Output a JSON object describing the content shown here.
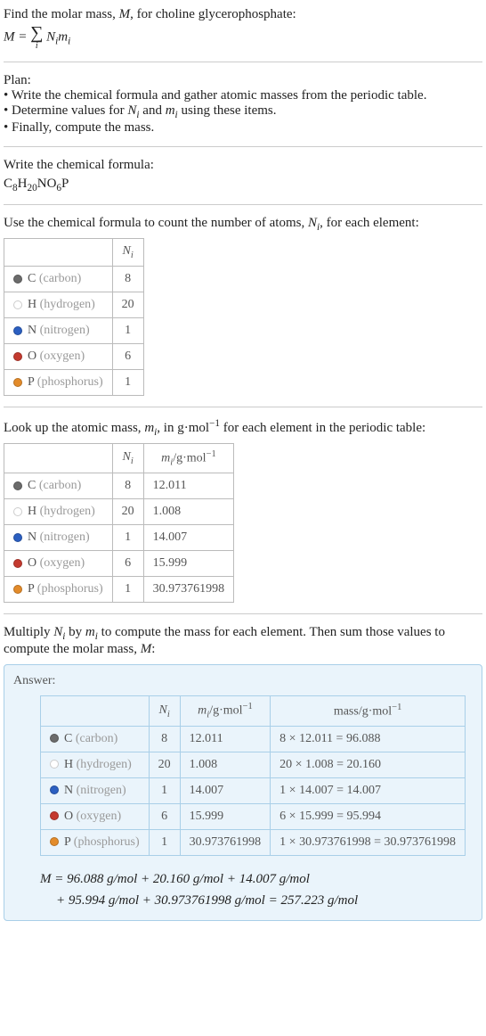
{
  "intro": {
    "line1": "Find the molar mass, ",
    "line1_var": "M",
    "line1_rest": ", for choline glycerophosphate:"
  },
  "equation_main": {
    "lhs": "M = ",
    "sum_symbol": "∑",
    "sum_index": "i",
    "rhs_Ni": "N",
    "rhs_i1": "i",
    "rhs_mi": "m",
    "rhs_i2": "i"
  },
  "plan": {
    "title": "Plan:",
    "item1_a": "• Write the chemical formula and gather atomic masses from the periodic table.",
    "item2_a": "• Determine values for ",
    "item2_Ni": "N",
    "item2_i1": "i",
    "item2_mid": " and ",
    "item2_mi": "m",
    "item2_i2": "i",
    "item2_end": " using these items.",
    "item3": "• Finally, compute the mass."
  },
  "chemformula": {
    "title": "Write the chemical formula:",
    "C": "C",
    "c8": "8",
    "H": "H",
    "h20": "20",
    "N": "N",
    "O": "O",
    "o6": "6",
    "P": "P"
  },
  "count_section": {
    "intro_a": "Use the chemical formula to count the number of atoms, ",
    "intro_Ni": "N",
    "intro_i": "i",
    "intro_b": ", for each element:"
  },
  "headers": {
    "Ni": "N",
    "Ni_i": "i",
    "mi_pre": "m",
    "mi_i": "i",
    "mi_unit": "/g·mol",
    "mi_exp": "−1",
    "mass_label": "mass/g·mol",
    "mass_exp": "−1"
  },
  "elements": [
    {
      "dot": "#6b6b6b",
      "sym": "C",
      "name": " (carbon)",
      "n": "8",
      "m": "12.011",
      "mass": "8 × 12.011 = 96.088"
    },
    {
      "dot": "#ffffff",
      "sym": "H",
      "name": " (hydrogen)",
      "n": "20",
      "m": "1.008",
      "mass": "20 × 1.008 = 20.160"
    },
    {
      "dot": "#2b5fc1",
      "sym": "N",
      "name": " (nitrogen)",
      "n": "1",
      "m": "14.007",
      "mass": "1 × 14.007 = 14.007"
    },
    {
      "dot": "#c43a2f",
      "sym": "O",
      "name": " (oxygen)",
      "n": "6",
      "m": "15.999",
      "mass": "6 × 15.999 = 95.994"
    },
    {
      "dot": "#e38b2a",
      "sym": "P",
      "name": " (phosphorus)",
      "n": "1",
      "m": "30.973761998",
      "mass": "1 × 30.973761998 = 30.973761998"
    }
  ],
  "lookup_section": {
    "intro_a": "Look up the atomic mass, ",
    "intro_mi": "m",
    "intro_i": "i",
    "intro_b": ", in g·mol",
    "intro_exp": "−1",
    "intro_c": " for each element in the periodic table:"
  },
  "multiply_section": {
    "text_a": "Multiply ",
    "Ni": "N",
    "i1": "i",
    "text_b": " by ",
    "mi": "m",
    "i2": "i",
    "text_c": " to compute the mass for each element. Then sum those values to compute the molar mass, ",
    "Mvar": "M",
    "text_d": ":"
  },
  "answer": {
    "label": "Answer:",
    "final_line1": "M = 96.088 g/mol + 20.160 g/mol + 14.007 g/mol",
    "final_line2": "+ 95.994 g/mol + 30.973761998 g/mol = 257.223 g/mol"
  }
}
